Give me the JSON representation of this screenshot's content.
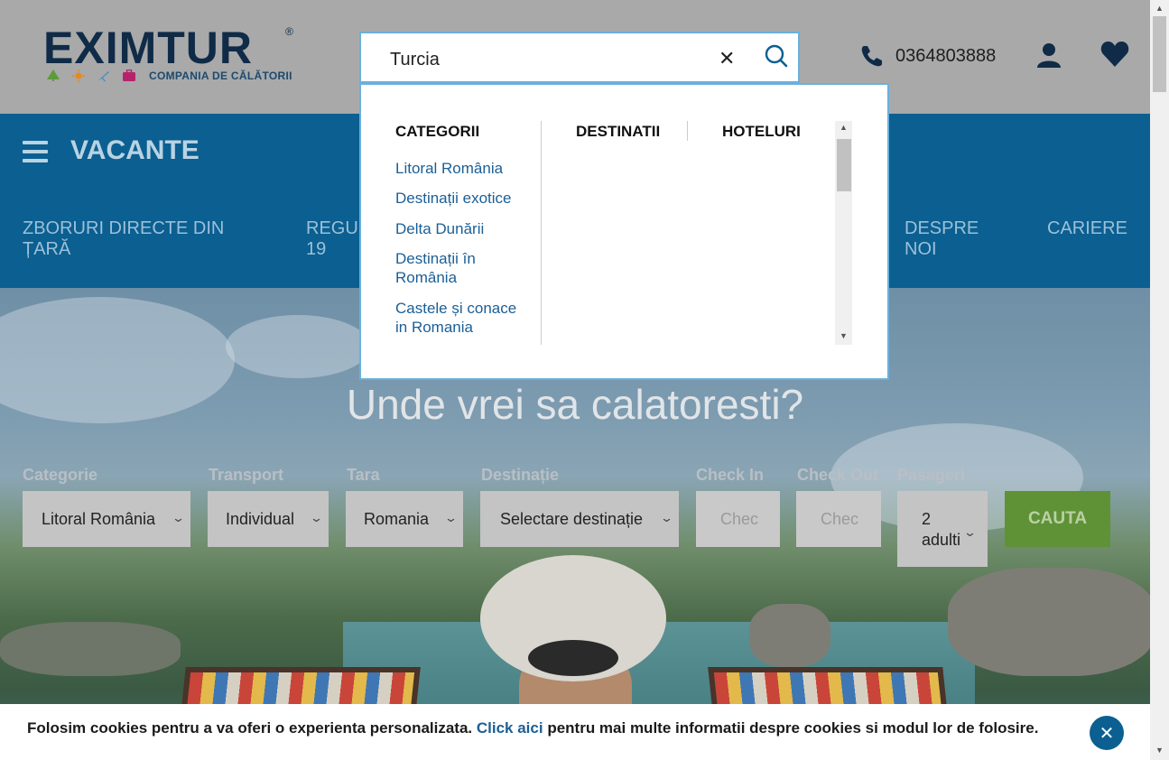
{
  "header": {
    "logo_text": "EXIMTUR",
    "logo_reg": "®",
    "logo_tagline": "COMPANIA DE CĂLĂTORII",
    "search_value": "Turcia",
    "clear_symbol": "✕",
    "phone": "0364803888",
    "icons": [
      "logo-tree-icon",
      "sun-icon",
      "plane-icon",
      "suitcase-icon",
      "search-icon",
      "phone-icon",
      "user-icon",
      "heart-icon"
    ]
  },
  "nav": {
    "menu_label": "VACANTE",
    "links": {
      "zboruri": "ZBORURI DIRECTE DIN ȚARĂ",
      "regu": "REGU",
      "regu2": "19",
      "despre": "DESPRE",
      "despre2": "NOI",
      "cariere": "CARIERE"
    }
  },
  "dropdown": {
    "col_categorii": "CATEGORII",
    "col_destinatii": "DESTINATII",
    "col_hoteluri": "HOTELURI",
    "categorii": [
      "Litoral România",
      "Destinații exotice",
      "Delta Dunării",
      "Destinații în",
      "România",
      "Castele și conace",
      "in Romania"
    ]
  },
  "hero": {
    "title": "Unde vrei sa calatoresti?"
  },
  "form": {
    "categorie_label": "Categorie",
    "categorie_value": "Litoral România",
    "transport_label": "Transport",
    "transport_value": "Individual",
    "tara_label": "Tara",
    "tara_value": "Romania",
    "destinatie_label": "Destinație",
    "destinatie_value": "Selectare destinație",
    "checkin_label": "Check In",
    "checkin_placeholder": "Chec",
    "checkout_label": "Check Out",
    "checkout_placeholder": "Chec",
    "pasageri_label": "Pasageri",
    "pasageri_value_1": "2",
    "pasageri_value_2": "adulti",
    "cauta_label": "CAUTA"
  },
  "cookie": {
    "text_before": "Folosim cookies pentru a va oferi o experienta personalizata. ",
    "link": "Click aici",
    "text_after": " pentru mai multe informatii despre cookies si modul lor de folosire.",
    "close_symbol": "✕"
  },
  "colors": {
    "header_bg": "#a9a9a9",
    "nav_bg": "#0b5f91",
    "brand_dark": "#0f2b47",
    "link_blue": "#1b5f96",
    "cauta_green": "#5f9237"
  }
}
